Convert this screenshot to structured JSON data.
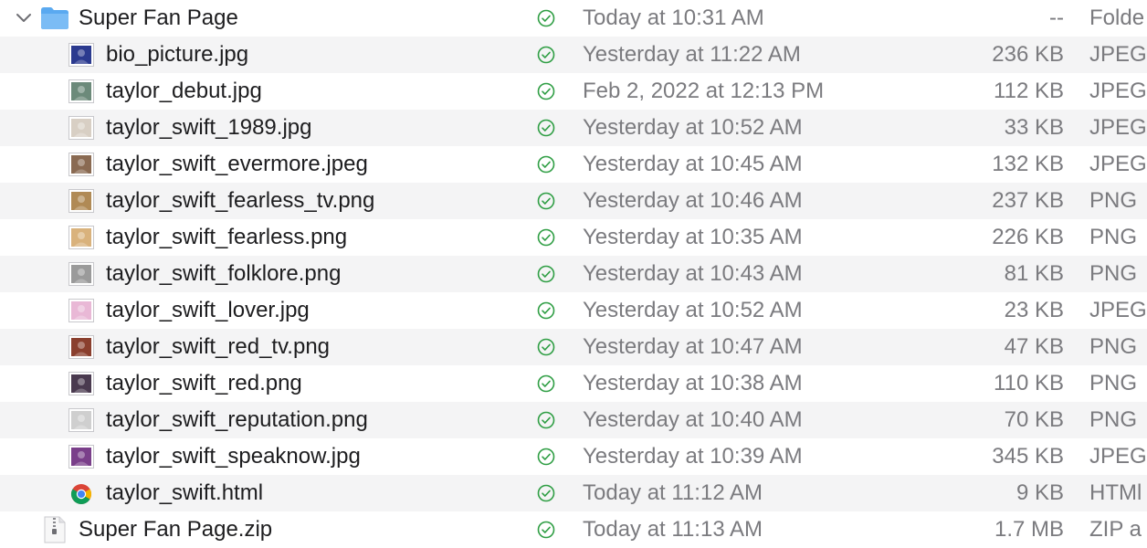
{
  "folder": {
    "name": "Super Fan Page",
    "date": "Today at 10:31 AM",
    "size": "--",
    "kind": "Folde",
    "icon": "folder-icon",
    "expanded": true
  },
  "files": [
    {
      "name": "bio_picture.jpg",
      "date": "Yesterday at 11:22 AM",
      "size": "236 KB",
      "kind": "JPEG",
      "icon": "image-thumbnail-icon",
      "thumb_color": "#2b3a8f"
    },
    {
      "name": "taylor_debut.jpg",
      "date": "Feb 2, 2022 at 12:13 PM",
      "size": "112 KB",
      "kind": "JPEG",
      "icon": "image-thumbnail-icon",
      "thumb_color": "#6c8a7a"
    },
    {
      "name": "taylor_swift_1989.jpg",
      "date": "Yesterday at 10:52 AM",
      "size": "33 KB",
      "kind": "JPEG",
      "icon": "image-thumbnail-icon",
      "thumb_color": "#d8cfc4"
    },
    {
      "name": "taylor_swift_evermore.jpeg",
      "date": "Yesterday at 10:45 AM",
      "size": "132 KB",
      "kind": "JPEG",
      "icon": "image-thumbnail-icon",
      "thumb_color": "#8a6a52"
    },
    {
      "name": "taylor_swift_fearless_tv.png",
      "date": "Yesterday at 10:46 AM",
      "size": "237 KB",
      "kind": "PNG",
      "icon": "image-thumbnail-icon",
      "thumb_color": "#b08a55"
    },
    {
      "name": "taylor_swift_fearless.png",
      "date": "Yesterday at 10:35 AM",
      "size": "226 KB",
      "kind": "PNG",
      "icon": "image-thumbnail-icon",
      "thumb_color": "#d9b27c"
    },
    {
      "name": "taylor_swift_folklore.png",
      "date": "Yesterday at 10:43 AM",
      "size": "81 KB",
      "kind": "PNG",
      "icon": "image-thumbnail-icon",
      "thumb_color": "#9a9a9a"
    },
    {
      "name": "taylor_swift_lover.jpg",
      "date": "Yesterday at 10:52 AM",
      "size": "23 KB",
      "kind": "JPEG",
      "icon": "image-thumbnail-icon",
      "thumb_color": "#e9b8d6"
    },
    {
      "name": "taylor_swift_red_tv.png",
      "date": "Yesterday at 10:47 AM",
      "size": "47 KB",
      "kind": "PNG",
      "icon": "image-thumbnail-icon",
      "thumb_color": "#8a3f2e"
    },
    {
      "name": "taylor_swift_red.png",
      "date": "Yesterday at 10:38 AM",
      "size": "110 KB",
      "kind": "PNG",
      "icon": "image-thumbnail-icon",
      "thumb_color": "#4a3a4f"
    },
    {
      "name": "taylor_swift_reputation.png",
      "date": "Yesterday at 10:40 AM",
      "size": "70 KB",
      "kind": "PNG",
      "icon": "image-thumbnail-icon",
      "thumb_color": "#cfcfcf"
    },
    {
      "name": "taylor_swift_speaknow.jpg",
      "date": "Yesterday at 10:39 AM",
      "size": "345 KB",
      "kind": "JPEG",
      "icon": "image-thumbnail-icon",
      "thumb_color": "#7a3f8a"
    },
    {
      "name": "taylor_swift.html",
      "date": "Today at 11:12 AM",
      "size": "9 KB",
      "kind": "HTMl",
      "icon": "chrome-html-icon",
      "thumb_color": ""
    }
  ],
  "zip": {
    "name": "Super Fan Page.zip",
    "date": "Today at 11:13 AM",
    "size": "1.7 MB",
    "kind": "ZIP a",
    "icon": "zip-archive-icon"
  },
  "colors": {
    "status_green": "#2f9e44",
    "folder_blue": "#5aa9f0",
    "stripe": "#f4f4f5",
    "secondary_text": "#7b7b7f"
  }
}
